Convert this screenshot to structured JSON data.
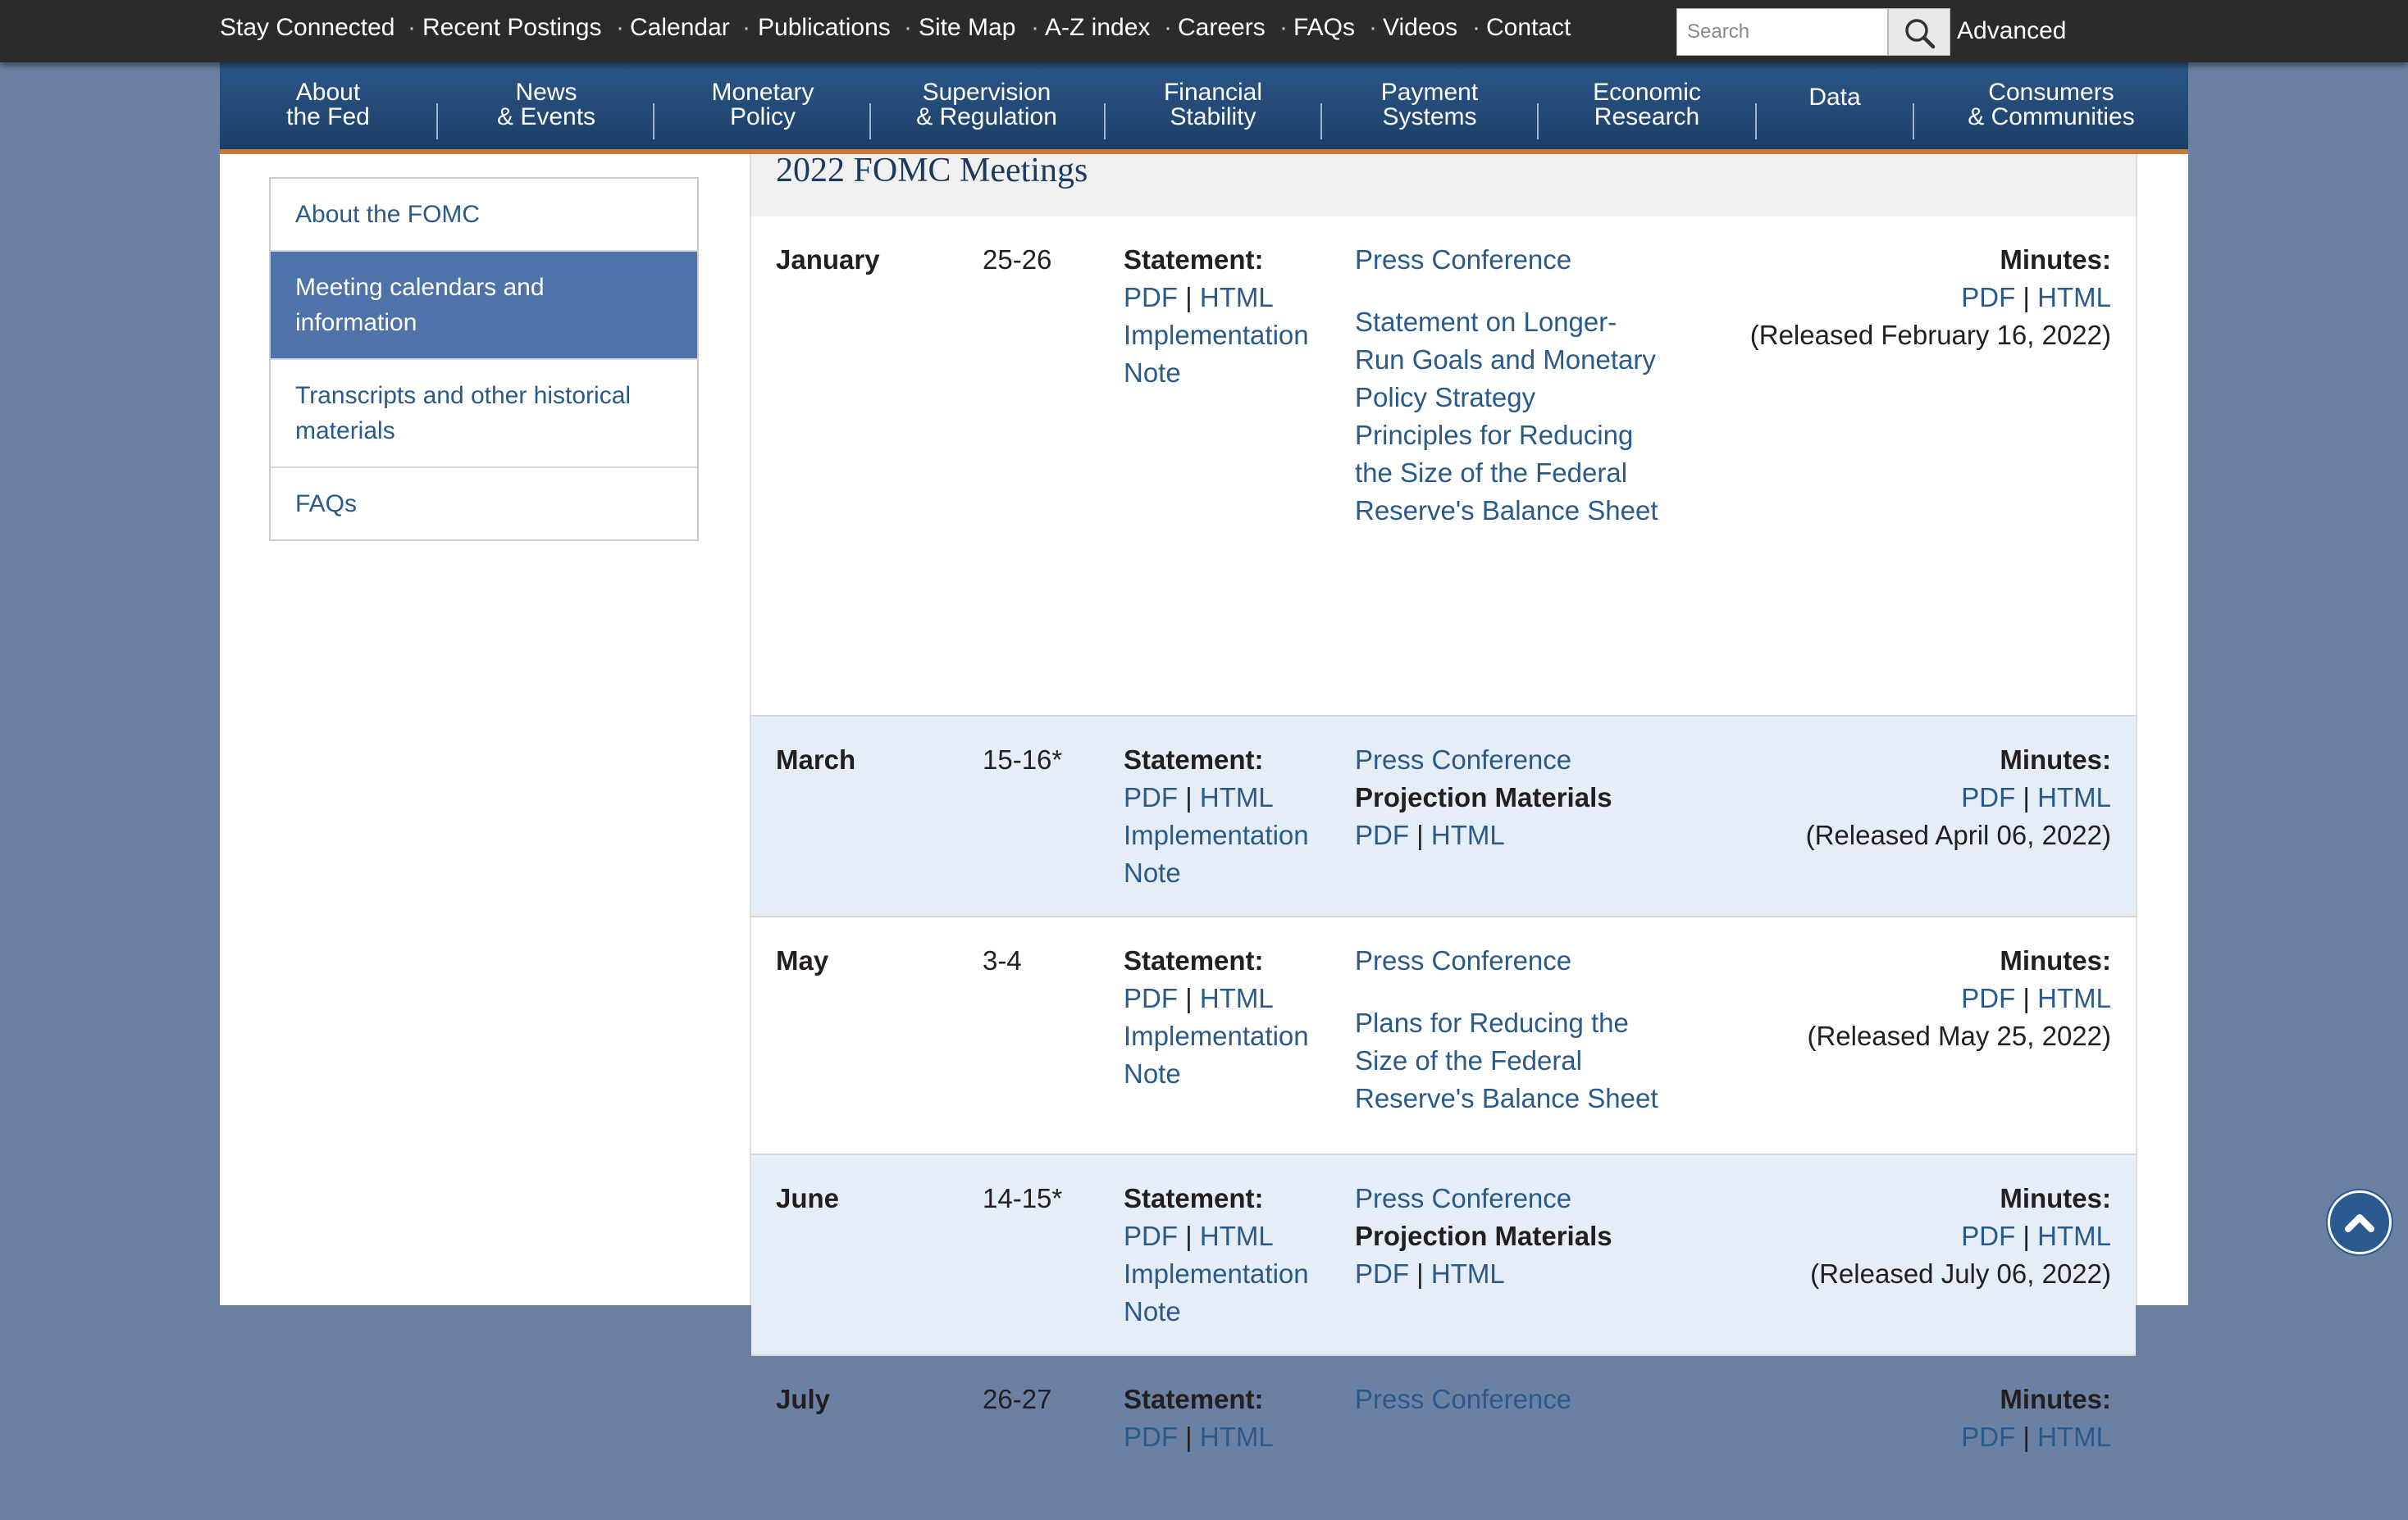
{
  "utility_nav": {
    "items": [
      "Stay Connected",
      "Recent Postings",
      "Calendar",
      "Publications",
      "Site Map",
      "A-Z index",
      "Careers",
      "FAQs",
      "Videos",
      "Contact"
    ],
    "search_placeholder": "Search",
    "advanced_label": "Advanced"
  },
  "main_nav": [
    {
      "l1": "About",
      "l2": "the Fed"
    },
    {
      "l1": "News",
      "l2": "& Events"
    },
    {
      "l1": "Monetary",
      "l2": "Policy"
    },
    {
      "l1": "Supervision",
      "l2": "& Regulation"
    },
    {
      "l1": "Financial",
      "l2": "Stability"
    },
    {
      "l1": "Payment",
      "l2": "Systems"
    },
    {
      "l1": "Economic",
      "l2": "Research"
    },
    {
      "l1": "Data",
      "l2": ""
    },
    {
      "l1": "Consumers",
      "l2": "& Communities"
    }
  ],
  "sidebar": {
    "items": [
      {
        "label": "About the FOMC",
        "active": false
      },
      {
        "label": "Meeting calendars and information",
        "active": true
      },
      {
        "label": "Transcripts and other historical materials",
        "active": false
      },
      {
        "label": "FAQs",
        "active": false
      }
    ]
  },
  "section": {
    "title": "2022 FOMC Meetings",
    "statement_label": "Statement:",
    "minutes_label": "Minutes:",
    "pdf": "PDF",
    "html": "HTML",
    "sep": "|",
    "impl_line1": "Implementation",
    "impl_line2": "Note",
    "press_conference": "Press Conference",
    "projection_materials": "Projection Materials"
  },
  "meetings": [
    {
      "month": "January",
      "dates": "25-26",
      "extra": [
        "Statement on Longer-",
        "Run Goals and Monetary",
        "Policy Strategy"
      ],
      "extra2": [
        "Principles for Reducing",
        "the Size of the Federal",
        "Reserve's Balance Sheet"
      ],
      "released": "(Released February 16, 2022)"
    },
    {
      "month": "March",
      "dates": "15-16*",
      "released": "(Released April 06, 2022)"
    },
    {
      "month": "May",
      "dates": "3-4",
      "extra": [
        "Plans for Reducing the",
        "Size of the Federal",
        "Reserve's Balance Sheet"
      ],
      "released": "(Released May 25, 2022)"
    },
    {
      "month": "June",
      "dates": "14-15*",
      "released": "(Released July 06, 2022)"
    },
    {
      "month": "July",
      "dates": "26-27"
    }
  ],
  "icons": {
    "search": "magnifier-icon",
    "back_to_top": "chevron-up-icon"
  },
  "colors": {
    "utility_bar": "#2b2b2d",
    "nav_blue": "#1c3f69",
    "nav_accent": "#c97a3a",
    "link": "#2a5a8a",
    "sidebar_active": "#4e73a8",
    "alt_row": "#e5edf6"
  }
}
